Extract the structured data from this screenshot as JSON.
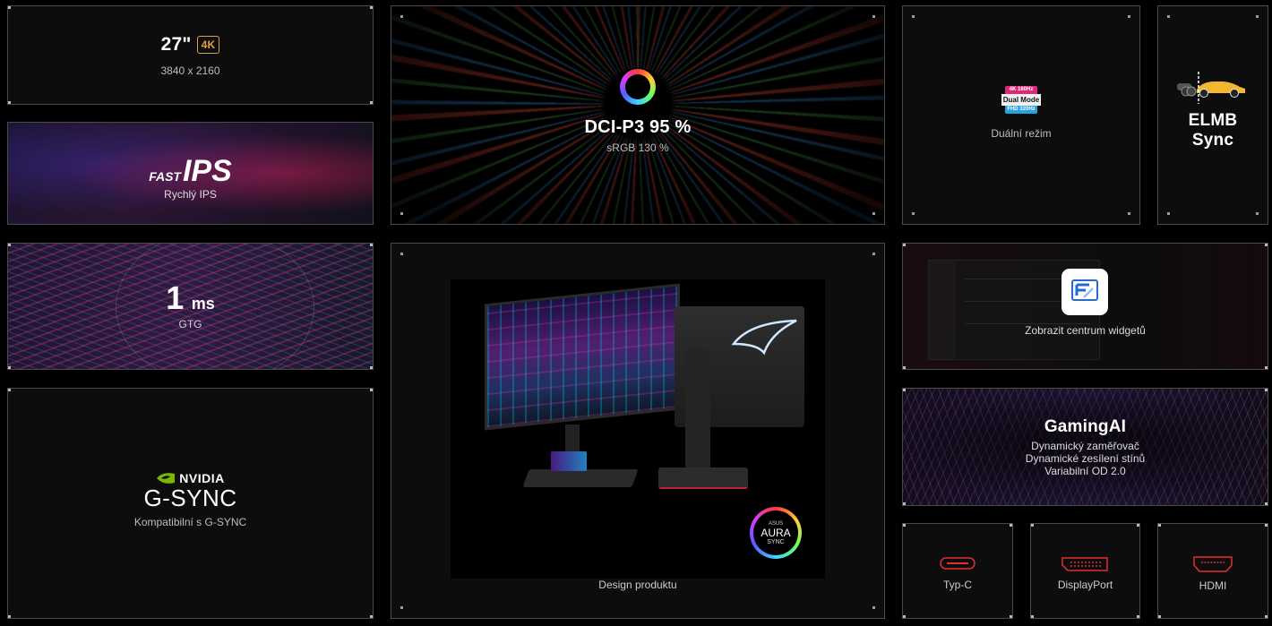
{
  "tiles": {
    "size": {
      "title": "27\"",
      "badge": "4K",
      "subtitle": "3840 x 2160"
    },
    "fast_ips": {
      "logo_small": "FAST",
      "logo_big": "IPS",
      "subtitle": "Rychlý IPS"
    },
    "dci": {
      "title": "DCI-P3 95 %",
      "subtitle": "sRGB 130 %"
    },
    "dual_mode": {
      "badge_top": "4K 160Hz",
      "badge_mid": "Dual Mode",
      "badge_bot": "FHD 320Hz",
      "subtitle": "Duální režim"
    },
    "elmb": {
      "title_line1": "ELMB",
      "title_line2": "Sync"
    },
    "response": {
      "value": "1",
      "unit": "ms",
      "subtitle": "GTG"
    },
    "design": {
      "subtitle": "Design produktu",
      "aura_brand": "ASUS",
      "aura_main": "AURA",
      "aura_sub": "SYNC"
    },
    "widget": {
      "subtitle": "Zobrazit centrum widgetů"
    },
    "gsync": {
      "brand": "NVIDIA",
      "title": "G-SYNC",
      "subtitle": "Kompatibilní s G-SYNC"
    },
    "gaming_ai": {
      "title": "GamingAI",
      "lines": [
        "Dynamický zaměřovač",
        "Dynamické zesílení stínů",
        "Variabilní OD 2.0"
      ]
    },
    "type_c": {
      "label": "Typ-C"
    },
    "displayport": {
      "label": "DisplayPort"
    },
    "hdmi": {
      "label": "HDMI"
    }
  },
  "colors": {
    "accent_orange": "#e0a040",
    "port_red": "#e03030",
    "tile_border": "#4a4a4a"
  }
}
